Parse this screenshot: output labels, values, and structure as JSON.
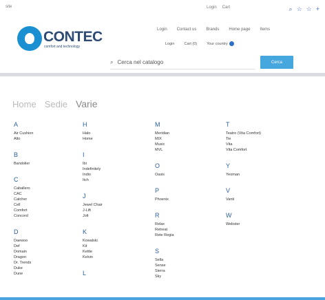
{
  "browser": {
    "left_text": "site",
    "mid_items": [
      "Login",
      "Cart"
    ],
    "icons": [
      "search-icon",
      "star-icon",
      "star-icon",
      "plus-icon"
    ]
  },
  "logo": {
    "name": "CONTEC",
    "tagline": "comfort and technology"
  },
  "nav_row1": [
    "Login",
    "Contact us",
    "Brands",
    "Home page",
    "Items"
  ],
  "nav_row2": {
    "login": "Login",
    "cart": "Cart (0)",
    "country": "Your country"
  },
  "search": {
    "placeholder": "Cerca nel catalogo",
    "button": "Cerca"
  },
  "breadcrumb": {
    "home": "Home",
    "mid": "Sedie",
    "current": "Varie"
  },
  "columns": [
    [
      {
        "letter": "A",
        "items": [
          "Air Cushion",
          "Alto"
        ]
      },
      {
        "letter": "B",
        "items": [
          "Bandolier"
        ]
      },
      {
        "letter": "C",
        "items": [
          "Caballero",
          "CAC",
          "Catcher",
          "Cell",
          "Comfort",
          "Concord"
        ]
      },
      {
        "letter": "D",
        "items": [
          "Daewoo",
          "Def",
          "Domain",
          "Dragon",
          "Dr. Trends",
          "Duke",
          "Dune"
        ]
      }
    ],
    [
      {
        "letter": "H",
        "items": [
          "Halo",
          "Home"
        ]
      },
      {
        "letter": "I",
        "items": [
          "Ibi",
          "Indefinitely",
          "Indio",
          "Itch"
        ]
      },
      {
        "letter": "J",
        "items": [
          "Jewel Chair",
          "J-Lift",
          "Jolt"
        ]
      },
      {
        "letter": "K",
        "items": [
          "Kowalski",
          "Kit",
          "Kettle",
          "Kelvin"
        ]
      },
      {
        "letter": "L",
        "items": []
      }
    ],
    [
      {
        "letter": "M",
        "items": [
          "Meridian",
          "MIX",
          "Music",
          "MVL"
        ]
      },
      {
        "letter": "O",
        "items": [
          "Oasis"
        ]
      },
      {
        "letter": "P",
        "items": [
          "Phoenix"
        ]
      },
      {
        "letter": "R",
        "items": [
          "Relax",
          "Retreat",
          "Rete Regia"
        ]
      },
      {
        "letter": "S",
        "items": [
          "Sella",
          "Sense",
          "Sierra",
          "Sky"
        ]
      }
    ],
    [
      {
        "letter": "T",
        "items": [
          "Teatro (Vita Comfort)",
          "Tie",
          "Vita",
          "Vita Comfort"
        ]
      },
      {
        "letter": "Y",
        "items": [
          "Yeoman"
        ]
      },
      {
        "letter": "V",
        "items": [
          "Vanti"
        ]
      },
      {
        "letter": "W",
        "items": [
          "Webster"
        ]
      }
    ]
  ],
  "colors": {
    "accent": "#46a6de",
    "brand": "#2c4a73",
    "letter": "#2d5f9a"
  }
}
